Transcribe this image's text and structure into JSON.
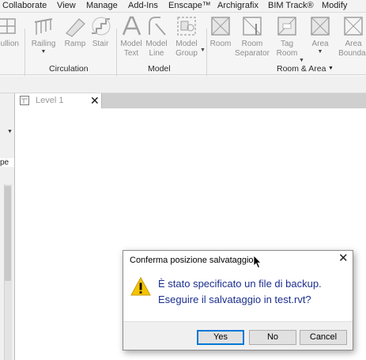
{
  "menu": {
    "tabs": [
      "Collaborate",
      "View",
      "Manage",
      "Add-Ins",
      "Enscape™",
      "Archigrafix",
      "BIM Track®",
      "Modify"
    ]
  },
  "ribbon": {
    "partial_left_label": "ullion",
    "tools": {
      "railing": "Railing",
      "ramp": "Ramp",
      "stair": "Stair",
      "model_text_1": "Model",
      "model_text_2": "Text",
      "model_line_1": "Model",
      "model_line_2": "Line",
      "model_group_1": "Model",
      "model_group_2": "Group",
      "room": "Room",
      "room_separator_1": "Room",
      "room_separator_2": "Separator",
      "tag_room_1": "Tag",
      "tag_room_2": "Room",
      "area": "Area",
      "area_boundary_1": "Area",
      "area_boundary_2": "Boundar"
    },
    "groups": {
      "circulation": "Circulation",
      "model": "Model",
      "room_area": "Room & Area"
    }
  },
  "left_panel": {
    "partial_label": "pe"
  },
  "view_tab": {
    "label": "Level 1"
  },
  "dialog": {
    "title": "Conferma posizione salvataggio",
    "message_line1": "È stato specificato un file di backup.",
    "message_line2": "Eseguire il salvataggio in test.rvt?",
    "buttons": {
      "yes": "Yes",
      "no": "No",
      "cancel": "Cancel"
    }
  },
  "colors": {
    "message_text": "#1c2f8e",
    "default_button_border": "#0078d7",
    "warning_icon": "#f5c400"
  }
}
